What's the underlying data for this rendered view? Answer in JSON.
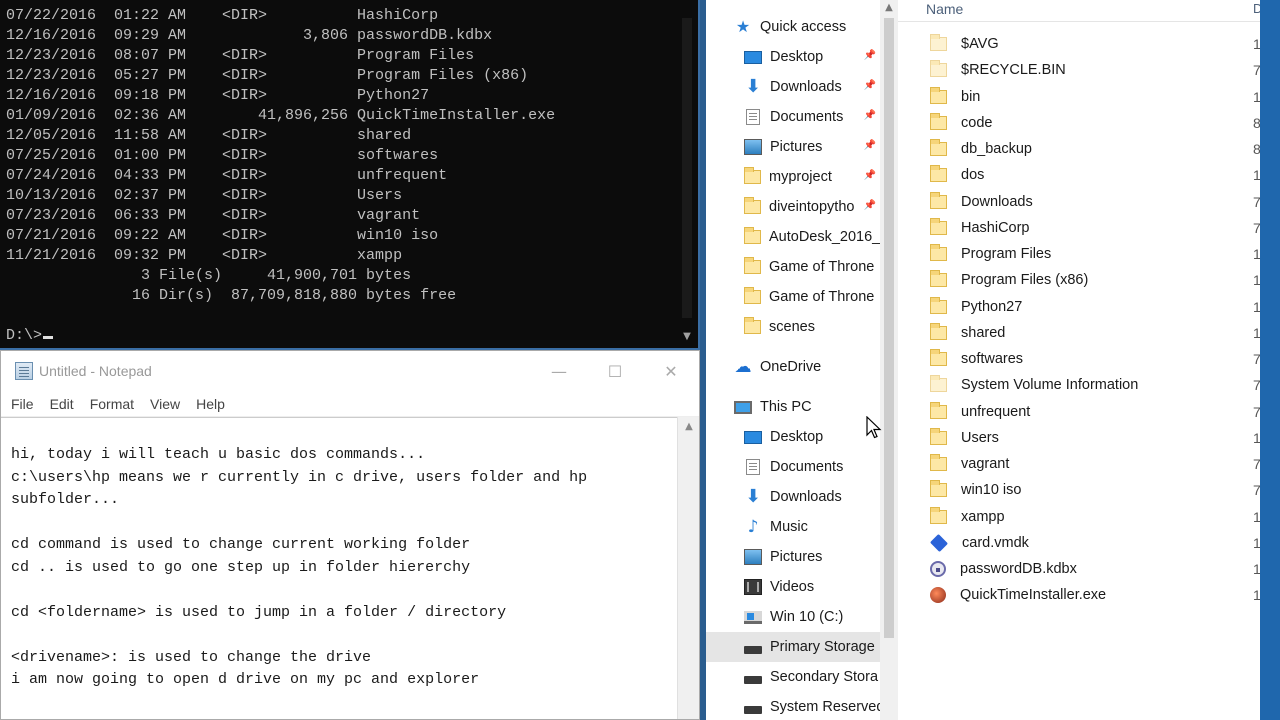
{
  "console": {
    "lines": [
      "07/22/2016  01:22 AM    <DIR>          HashiCorp",
      "12/16/2016  09:29 AM             3,806 passwordDB.kdbx",
      "12/23/2016  08:07 PM    <DIR>          Program Files",
      "12/23/2016  05:27 PM    <DIR>          Program Files (x86)",
      "12/16/2016  09:18 PM    <DIR>          Python27",
      "01/09/2016  02:36 AM        41,896,256 QuickTimeInstaller.exe",
      "12/05/2016  11:58 AM    <DIR>          shared",
      "07/25/2016  01:00 PM    <DIR>          softwares",
      "07/24/2016  04:33 PM    <DIR>          unfrequent",
      "10/13/2016  02:37 PM    <DIR>          Users",
      "07/23/2016  06:33 PM    <DIR>          vagrant",
      "07/21/2016  09:22 AM    <DIR>          win10 iso",
      "11/21/2016  09:32 PM    <DIR>          xampp",
      "               3 File(s)     41,900,701 bytes",
      "              16 Dir(s)  87,709,818,880 bytes free",
      ""
    ],
    "prompt": "D:\\>"
  },
  "notepad": {
    "title": "Untitled - Notepad",
    "menu": [
      "File",
      "Edit",
      "Format",
      "View",
      "Help"
    ],
    "lines": [
      "hi, today i will teach u basic dos commands...",
      "c:\\users\\hp means we r currently in c drive, users folder and hp",
      "subfolder...",
      "",
      "cd command is used to change current working folder",
      "cd .. is used to go one step up in folder hiererchy",
      "",
      "cd <foldername> is used to jump in a folder / directory",
      "",
      "<drivename>: is used to change the drive",
      "i am now going to open d drive on my pc and explorer"
    ]
  },
  "explorer": {
    "nav": [
      {
        "label": "Quick access",
        "icon": "star-icon",
        "indent": 0,
        "pinned": false
      },
      {
        "label": "Desktop",
        "icon": "desktop-icon",
        "indent": 1,
        "pinned": true
      },
      {
        "label": "Downloads",
        "icon": "downloads-icon",
        "indent": 1,
        "pinned": true
      },
      {
        "label": "Documents",
        "icon": "documents-icon",
        "indent": 1,
        "pinned": true
      },
      {
        "label": "Pictures",
        "icon": "pictures-icon",
        "indent": 1,
        "pinned": true
      },
      {
        "label": "myproject",
        "icon": "folder-icon",
        "indent": 1,
        "pinned": true
      },
      {
        "label": "diveintopytho",
        "icon": "folder-icon",
        "indent": 1,
        "pinned": true
      },
      {
        "label": "AutoDesk_2016_",
        "icon": "folder-icon",
        "indent": 1,
        "pinned": false
      },
      {
        "label": "Game of Throne",
        "icon": "folder-icon",
        "indent": 1,
        "pinned": false
      },
      {
        "label": "Game of Throne",
        "icon": "folder-icon",
        "indent": 1,
        "pinned": false
      },
      {
        "label": "scenes",
        "icon": "folder-icon",
        "indent": 1,
        "pinned": false
      },
      {
        "label": "OneDrive",
        "icon": "onedrive-icon",
        "indent": 0,
        "pinned": false,
        "selected": true
      },
      {
        "label": "This PC",
        "icon": "this-pc-icon",
        "indent": 0,
        "pinned": false
      },
      {
        "label": "Desktop",
        "icon": "desktop-icon",
        "indent": 1,
        "pinned": false
      },
      {
        "label": "Documents",
        "icon": "documents-icon",
        "indent": 1,
        "pinned": false
      },
      {
        "label": "Downloads",
        "icon": "downloads-icon",
        "indent": 1,
        "pinned": false
      },
      {
        "label": "Music",
        "icon": "music-icon",
        "indent": 1,
        "pinned": false
      },
      {
        "label": "Pictures",
        "icon": "pictures-icon",
        "indent": 1,
        "pinned": false
      },
      {
        "label": "Videos",
        "icon": "videos-icon",
        "indent": 1,
        "pinned": false
      },
      {
        "label": "Win 10 (C:)",
        "icon": "windows-drive-icon",
        "indent": 1,
        "pinned": false
      },
      {
        "label": "Primary Storage",
        "icon": "drive-icon",
        "indent": 1,
        "pinned": false,
        "selected": true
      },
      {
        "label": "Secondary Stora",
        "icon": "drive-icon",
        "indent": 1,
        "pinned": false
      },
      {
        "label": "System Reserved",
        "icon": "drive-icon",
        "indent": 1,
        "pinned": false
      }
    ],
    "columns": {
      "name": "Name",
      "date": "D"
    },
    "files": [
      {
        "name": "$AVG",
        "icon": "folder-faded",
        "date": "1"
      },
      {
        "name": "$RECYCLE.BIN",
        "icon": "folder-faded",
        "date": "7"
      },
      {
        "name": "bin",
        "icon": "folder",
        "date": "1"
      },
      {
        "name": "code",
        "icon": "folder",
        "date": "8"
      },
      {
        "name": "db_backup",
        "icon": "folder",
        "date": "8"
      },
      {
        "name": "dos",
        "icon": "folder",
        "date": "1"
      },
      {
        "name": "Downloads",
        "icon": "folder",
        "date": "7"
      },
      {
        "name": "HashiCorp",
        "icon": "folder",
        "date": "7"
      },
      {
        "name": "Program Files",
        "icon": "folder",
        "date": "1"
      },
      {
        "name": "Program Files (x86)",
        "icon": "folder",
        "date": "1"
      },
      {
        "name": "Python27",
        "icon": "folder",
        "date": "1"
      },
      {
        "name": "shared",
        "icon": "folder",
        "date": "1"
      },
      {
        "name": "softwares",
        "icon": "folder",
        "date": "7"
      },
      {
        "name": "System Volume Information",
        "icon": "folder-faded",
        "date": "7"
      },
      {
        "name": "unfrequent",
        "icon": "folder",
        "date": "7"
      },
      {
        "name": "Users",
        "icon": "folder",
        "date": "1"
      },
      {
        "name": "vagrant",
        "icon": "folder",
        "date": "7"
      },
      {
        "name": "win10 iso",
        "icon": "folder",
        "date": "7"
      },
      {
        "name": "xampp",
        "icon": "folder",
        "date": "1"
      },
      {
        "name": "card.vmdk",
        "icon": "vmdk",
        "date": "1"
      },
      {
        "name": "passwordDB.kdbx",
        "icon": "kdbx",
        "date": "1"
      },
      {
        "name": "QuickTimeInstaller.exe",
        "icon": "quicktime",
        "date": "1"
      }
    ]
  }
}
